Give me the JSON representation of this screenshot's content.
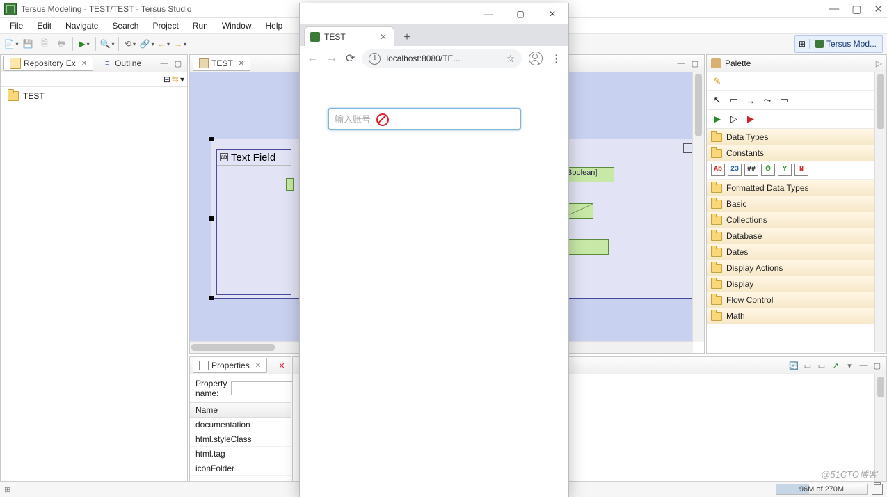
{
  "ide": {
    "title": "Tersus Modeling - TEST/TEST - Tersus Studio",
    "menus": [
      "File",
      "Edit",
      "Navigate",
      "Search",
      "Project",
      "Run",
      "Window",
      "Help"
    ],
    "perspective_open_tip": "Open Perspective",
    "perspective_label": "Tersus Mod..."
  },
  "repoView": {
    "tab1": "Repository Ex",
    "tab2": "Outline",
    "treeItem": "TEST"
  },
  "editor": {
    "tab": "TEST",
    "textFieldLabel": "Text Field",
    "booleanLabel": "[Boolean]"
  },
  "propsView": {
    "tab": "Properties",
    "propNameLabel": "Property name:",
    "colHeader": "Name",
    "rows": [
      "documentation",
      "html.styleClass",
      "html.tag",
      "iconFolder"
    ]
  },
  "palette": {
    "title": "Palette",
    "drawers": [
      "Data Types",
      "Constants",
      "Formatted Data Types",
      "Basic",
      "Collections",
      "Database",
      "Dates",
      "Display Actions",
      "Display",
      "Flow Control",
      "Math"
    ],
    "constIcons": [
      "Ab",
      "23",
      "##",
      "⏱",
      "Y",
      "N"
    ]
  },
  "status": {
    "memText": "96M of 270M"
  },
  "browser": {
    "tab": "TEST",
    "url": "localhost:8080/TE...",
    "inputPlaceholder": "输入账号"
  },
  "watermark": "@51CTO博客"
}
